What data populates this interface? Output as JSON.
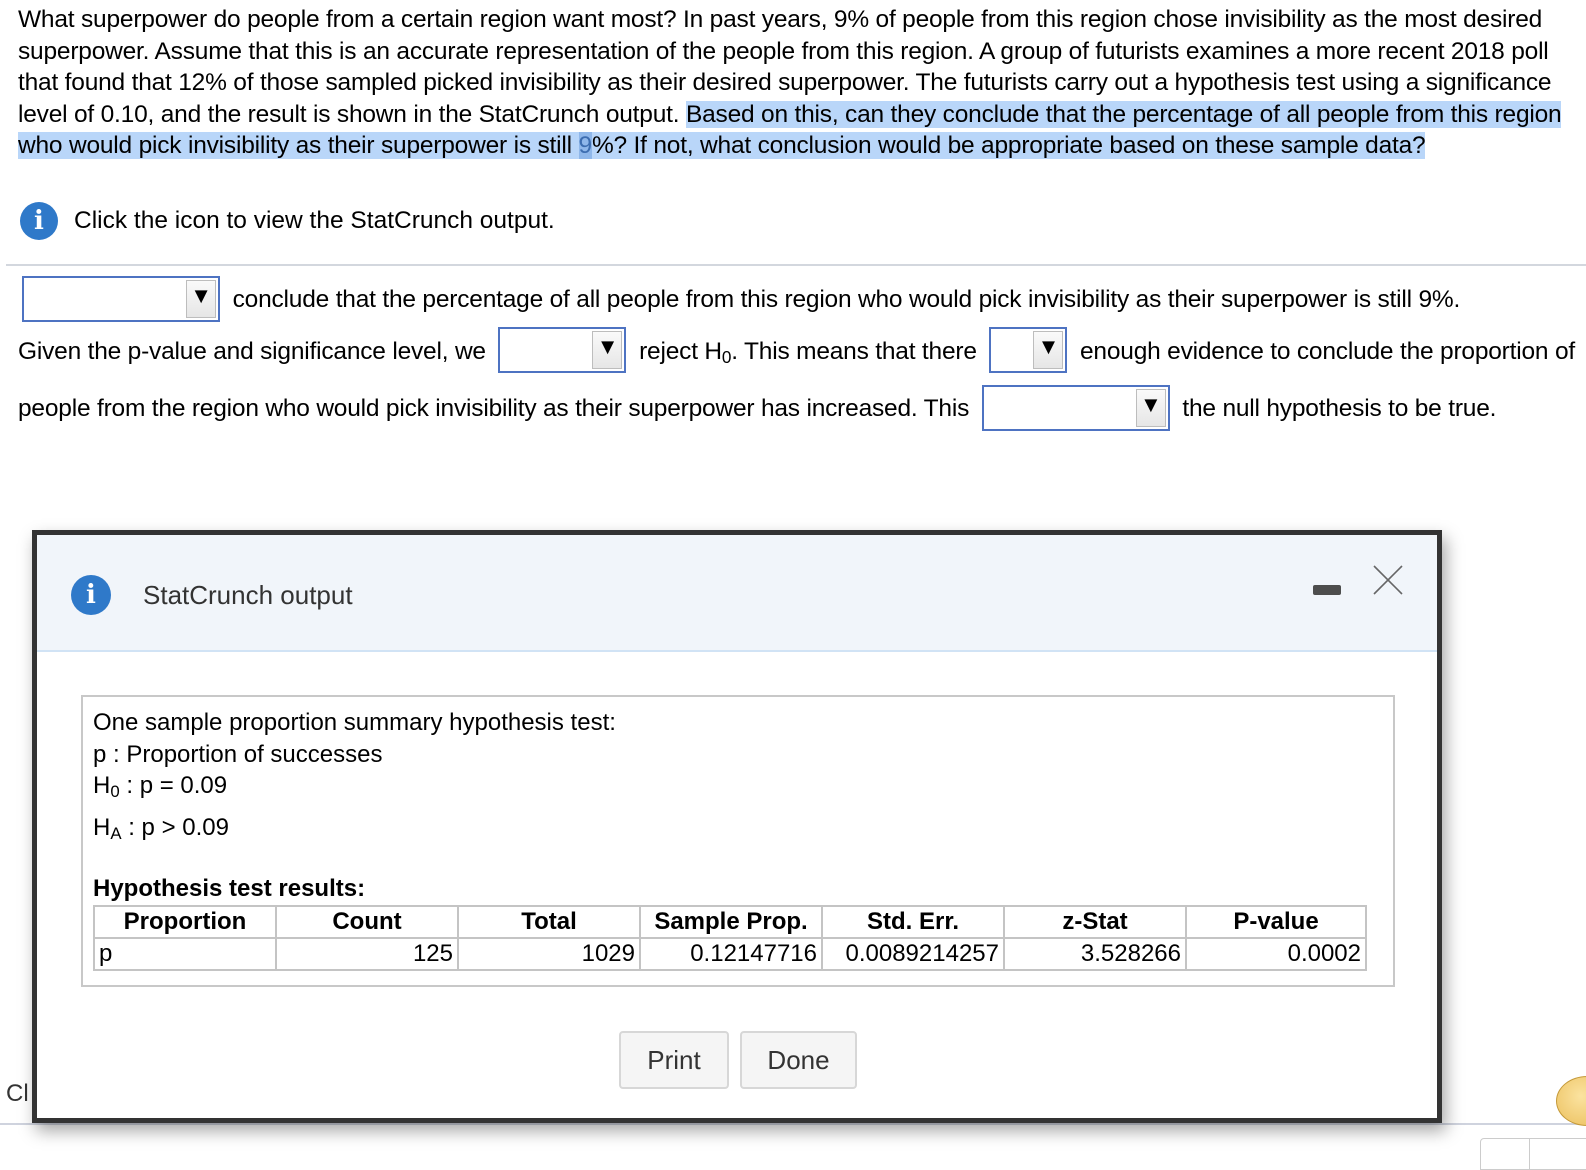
{
  "question": {
    "text_plain": "What superpower do people from a certain region want most? In past years, 9% of people from this region chose invisibility as the most desired superpower. Assume that this is an accurate representation of the people from this region. A group of futurists examines a more recent 2018 poll that found that 12% of those sampled picked invisibility as their desired superpower. The futurists carry out a hypothesis test using a significance level of 0.10, and the result is shown in the StatCrunch output. ",
    "text_highlight_1": "Based on this, can they conclude that the percentage of all people from this region who would pick invisibility as their superpower is still ",
    "text_highlight_strong": "9",
    "text_highlight_2": "%? If not, what conclusion would be appropriate based on these sample data?"
  },
  "info_link": {
    "icon": "info-icon",
    "text": "Click the icon to view the StatCrunch output."
  },
  "answer": {
    "dropdown_1": {
      "value": ""
    },
    "seg_1": "conclude that the percentage of all people from this region who would pick invisibility as their superpower is still 9%.",
    "seg_2": "Given the p-value and significance level, we",
    "dropdown_2": {
      "value": ""
    },
    "seg_3a": "reject H",
    "seg_3_sub": "0",
    "seg_3b": ". This means that there",
    "dropdown_3": {
      "value": ""
    },
    "seg_4": "enough evidence to conclude the proportion of people from the region who would pick invisibility as their superpower has increased. This",
    "dropdown_4": {
      "value": ""
    },
    "seg_5": "the null hypothesis to be true.",
    "dropdown_arrow": "▼"
  },
  "background_fragment": "Cl",
  "modal": {
    "icon": "info-icon",
    "title": "StatCrunch output",
    "minimize_icon": "minimize-icon",
    "close_icon": "close-icon",
    "output": {
      "heading": "One sample proportion summary hypothesis test:",
      "param_line": "p : Proportion of successes",
      "h0_label": "H",
      "h0_sub": "0",
      "h0_rest": " : p = 0.09",
      "ha_label": "H",
      "ha_sub": "A",
      "ha_rest": " : p > 0.09",
      "results_title": "Hypothesis test results:",
      "columns": [
        "Proportion",
        "Count",
        "Total",
        "Sample Prop.",
        "Std. Err.",
        "z-Stat",
        "P-value"
      ],
      "rows": [
        [
          "p",
          "125",
          "1029",
          "0.12147716",
          "0.0089214257",
          "3.528266",
          "0.0002"
        ]
      ]
    },
    "buttons": {
      "print": "Print",
      "done": "Done"
    }
  }
}
